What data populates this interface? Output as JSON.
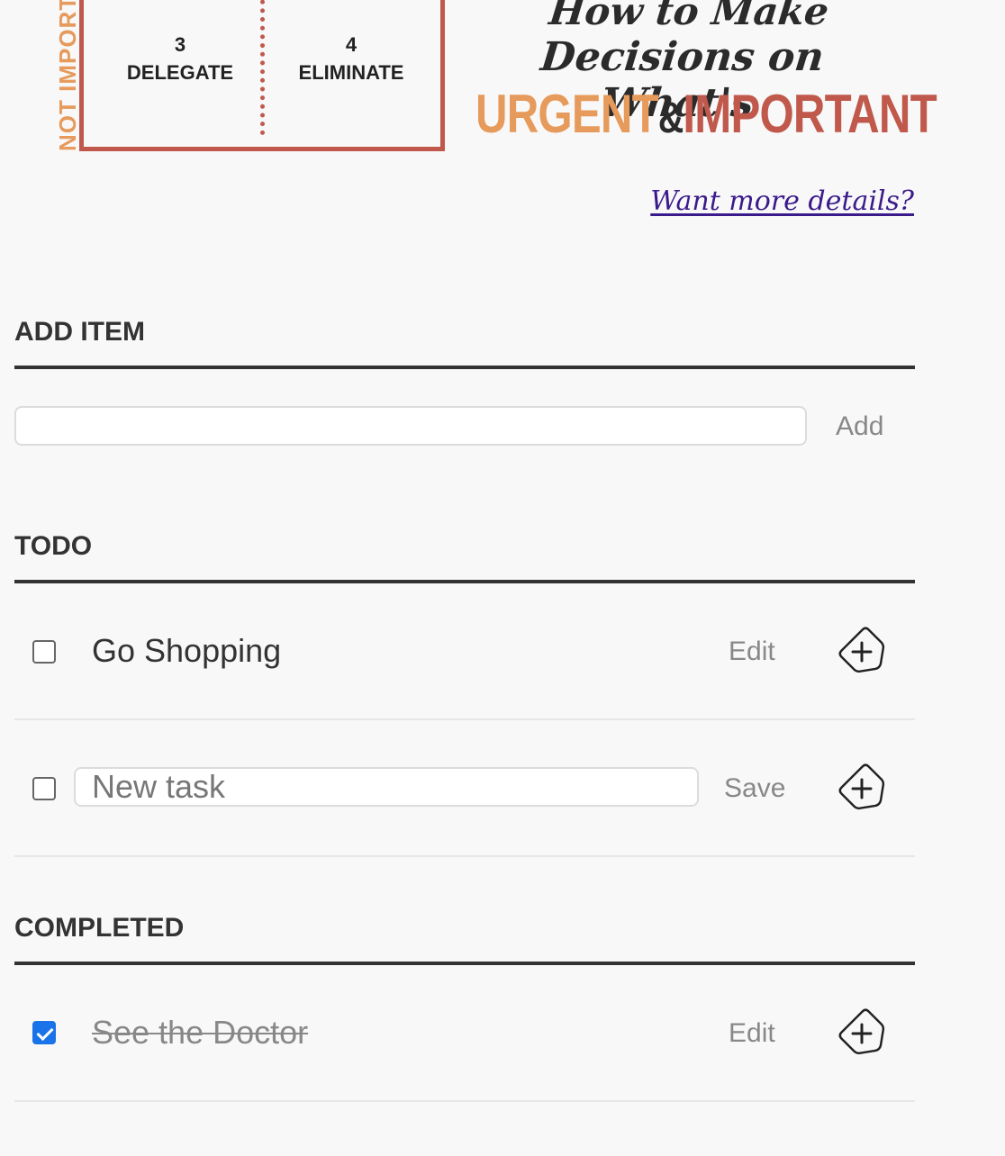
{
  "banner": {
    "side_label": "NOT IMPORTANT",
    "quadrant3_number": "3",
    "quadrant3_label": "DELEGATE",
    "quadrant4_number": "4",
    "quadrant4_label": "ELIMINATE",
    "title_line1": "How to Make",
    "title_line2": "Decisions on What's",
    "title_urgent": "URGENT",
    "title_amp": "&",
    "title_important": "IMPORTANT",
    "accent_orange": "#e69a5b",
    "accent_red": "#c0594c"
  },
  "details_link": "Want more details?",
  "add_section": {
    "title": "ADD ITEM",
    "input_value": "",
    "button_label": "Add"
  },
  "todo_section": {
    "title": "TODO",
    "items": [
      {
        "label": "Go Shopping",
        "checked": false,
        "button_label": "Edit",
        "icon": "tag-plus-icon"
      },
      {
        "edit_value": "New task",
        "checked": false,
        "button_label": "Save",
        "icon": "tag-plus-icon"
      }
    ]
  },
  "completed_section": {
    "title": "COMPLETED",
    "items": [
      {
        "label": "See the Doctor",
        "checked": true,
        "button_label": "Edit",
        "icon": "tag-plus-icon"
      }
    ]
  },
  "colors": {
    "checkbox_checked": "#1a73e8",
    "link": "#3b1b8c"
  }
}
